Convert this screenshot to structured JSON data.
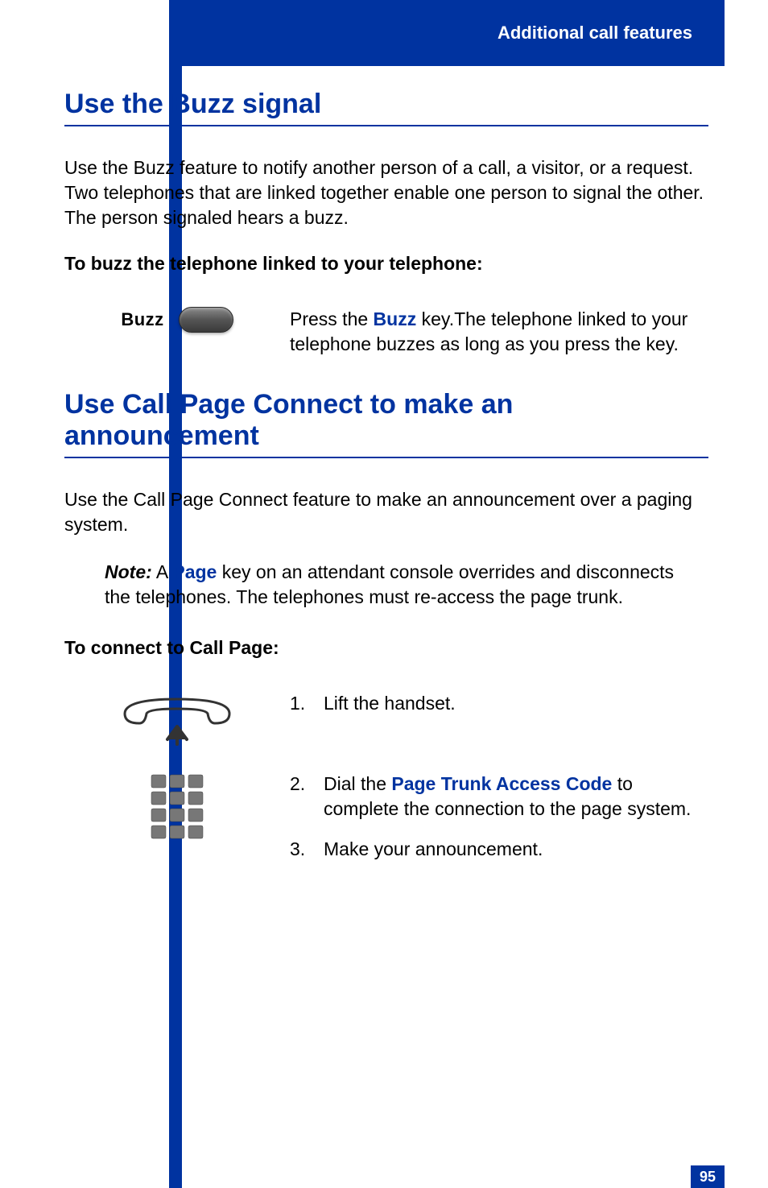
{
  "header": {
    "title": "Additional call features"
  },
  "page_number": "95",
  "section1": {
    "heading": "Use the Buzz signal",
    "intro": "Use the Buzz feature to notify another person of a call, a visitor, or a request. Two telephones that are linked together enable one person to signal the other. The person signaled hears a buzz.",
    "subheading": "To buzz the telephone linked to your telephone:",
    "key_label": "Buzz",
    "step_prefix": "Press the ",
    "step_keyword": "Buzz",
    "step_suffix": " key.The telephone linked to your telephone buzzes as long as you press the key."
  },
  "section2": {
    "heading": "Use Call Page Connect to make an announcement",
    "intro": "Use the Call Page Connect feature to make an announcement over a paging system.",
    "note_label": "Note:",
    "note_prefix": " A ",
    "note_keyword": "Page",
    "note_suffix": " key on an attendant console overrides and disconnects the telephones. The telephones must re-access the page trunk.",
    "subheading": "To connect to Call Page:",
    "steps": {
      "s1": "Lift the handset.",
      "s2_prefix": "Dial the ",
      "s2_keyword": "Page Trunk Access Code",
      "s2_suffix": " to complete the connection to the page system.",
      "s3": "Make your announcement."
    }
  }
}
